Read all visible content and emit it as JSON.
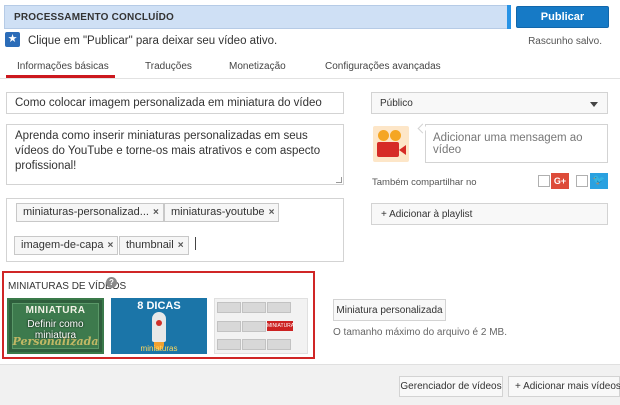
{
  "status": {
    "text": "PROCESSAMENTO CONCLUÍDO",
    "publish_label": "Publicar"
  },
  "hint": {
    "icon": "star-icon",
    "text": "Clique em \"Publicar\" para deixar seu vídeo ativo.",
    "draft": "Rascunho salvo."
  },
  "tabs": [
    {
      "label": "Informações básicas",
      "active": true
    },
    {
      "label": "Traduções"
    },
    {
      "label": "Monetização"
    },
    {
      "label": "Configurações avançadas"
    }
  ],
  "form": {
    "title": "Como colocar imagem personalizada em miniatura do vídeo",
    "description": "Aprenda como inserir miniaturas personalizadas em seus vídeos do YouTube e torne-os mais atrativos e com aspecto profissional!",
    "tags": [
      "miniaturas-personalizad...",
      "miniaturas-youtube",
      "imagem-de-capa",
      "thumbnail"
    ],
    "tag_remove": "×"
  },
  "thumbnails": {
    "label": "MINIATURAS DE VÍDEOS",
    "help": "?",
    "items": [
      {
        "heading": "MINIATURA",
        "script": "Personalizada",
        "overlay": "Definir como miniatura",
        "selected": true
      },
      {
        "heading": "8 DICAS",
        "caption": "miniaturas"
      },
      {
        "badge": "MINIATURA"
      }
    ],
    "custom_label": "Miniatura personalizada",
    "max_size": "O tamanho máximo do arquivo é 2 MB."
  },
  "sidebar": {
    "visibility": "Público",
    "share_placeholder": "Adicionar uma mensagem ao vídeo",
    "share_label": "Também compartilhar no",
    "gplus": "G+",
    "twitter_icon": "twitter-icon",
    "playlist_label": "+ Adicionar à playlist"
  },
  "footer": {
    "video_manager": "Gerenciador de vídeos",
    "add_more": "+ Adicionar mais vídeos"
  },
  "colors": {
    "publish": "#167ac6",
    "status_bg": "#cfe0f5",
    "tab_active": "#cc181e",
    "highlight": "#d02626"
  }
}
